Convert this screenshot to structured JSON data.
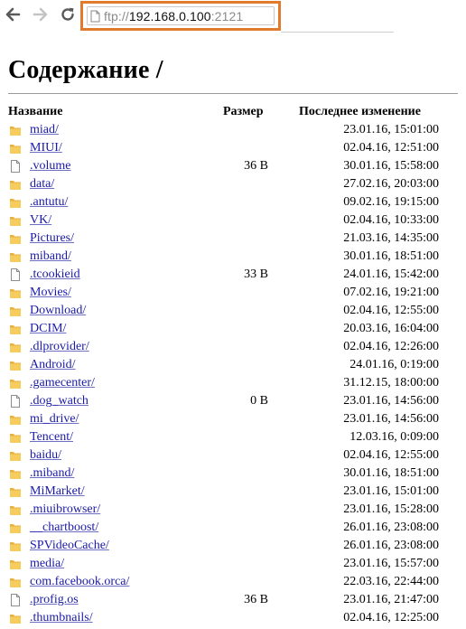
{
  "browser": {
    "url_scheme": "ftp://",
    "url_host": "192.168.0.100",
    "url_port": ":2121"
  },
  "page": {
    "title": "Содержание /",
    "columns": {
      "name": "Название",
      "size": "Размер",
      "modified": "Последнее изменение"
    }
  },
  "entries": [
    {
      "name": "miad/",
      "type": "folder",
      "size": "",
      "modified": "23.01.16, 15:01:00"
    },
    {
      "name": "MIUI/",
      "type": "folder",
      "size": "",
      "modified": "02.04.16, 12:51:00"
    },
    {
      "name": ".volume",
      "type": "file",
      "size": "36 B",
      "modified": "30.01.16, 15:58:00"
    },
    {
      "name": "data/",
      "type": "folder",
      "size": "",
      "modified": "27.02.16, 20:03:00"
    },
    {
      "name": ".antutu/",
      "type": "folder",
      "size": "",
      "modified": "09.02.16, 19:15:00"
    },
    {
      "name": "VK/",
      "type": "folder",
      "size": "",
      "modified": "02.04.16, 10:33:00"
    },
    {
      "name": "Pictures/",
      "type": "folder",
      "size": "",
      "modified": "21.03.16, 14:35:00"
    },
    {
      "name": "miband/",
      "type": "folder",
      "size": "",
      "modified": "30.01.16, 18:51:00"
    },
    {
      "name": ".tcookieid",
      "type": "file",
      "size": "33 B",
      "modified": "24.01.16, 15:42:00"
    },
    {
      "name": "Movies/",
      "type": "folder",
      "size": "",
      "modified": "07.02.16, 19:21:00"
    },
    {
      "name": "Download/",
      "type": "folder",
      "size": "",
      "modified": "02.04.16, 12:55:00"
    },
    {
      "name": "DCIM/",
      "type": "folder",
      "size": "",
      "modified": "20.03.16, 16:04:00"
    },
    {
      "name": ".dlprovider/",
      "type": "folder",
      "size": "",
      "modified": "02.04.16, 12:26:00"
    },
    {
      "name": "Android/",
      "type": "folder",
      "size": "",
      "modified": "24.01.16, 0:19:00"
    },
    {
      "name": ".gamecenter/",
      "type": "folder",
      "size": "",
      "modified": "31.12.15, 18:00:00"
    },
    {
      "name": ".dog_watch",
      "type": "file",
      "size": "0 B",
      "modified": "23.01.16, 14:56:00"
    },
    {
      "name": "mi_drive/",
      "type": "folder",
      "size": "",
      "modified": "23.01.16, 14:56:00"
    },
    {
      "name": "Tencent/",
      "type": "folder",
      "size": "",
      "modified": "12.03.16, 0:09:00"
    },
    {
      "name": "baidu/",
      "type": "folder",
      "size": "",
      "modified": "02.04.16, 12:55:00"
    },
    {
      "name": ".miband/",
      "type": "folder",
      "size": "",
      "modified": "30.01.16, 18:51:00"
    },
    {
      "name": "MiMarket/",
      "type": "folder",
      "size": "",
      "modified": "23.01.16, 15:01:00"
    },
    {
      "name": ".miuibrowser/",
      "type": "folder",
      "size": "",
      "modified": "23.01.16, 15:28:00"
    },
    {
      "name": "__chartboost/",
      "type": "folder",
      "size": "",
      "modified": "26.01.16, 23:08:00"
    },
    {
      "name": "SPVideoCache/",
      "type": "folder",
      "size": "",
      "modified": "26.01.16, 23:08:00"
    },
    {
      "name": "media/",
      "type": "folder",
      "size": "",
      "modified": "23.01.16, 15:57:00"
    },
    {
      "name": "com.facebook.orca/",
      "type": "folder",
      "size": "",
      "modified": "22.03.16, 22:44:00"
    },
    {
      "name": ".profig.os",
      "type": "file",
      "size": "36 B",
      "modified": "23.01.16, 21:47:00"
    },
    {
      "name": ".thumbnails/",
      "type": "folder",
      "size": "",
      "modified": "02.04.16, 12:25:00"
    }
  ],
  "icons": {
    "back": "back-arrow-icon",
    "forward": "forward-arrow-icon",
    "reload": "reload-icon",
    "page": "page-icon",
    "folder": "folder-icon",
    "file": "file-icon"
  },
  "colors": {
    "link": "#1a1aa6",
    "url_highlight": "#e07a2c",
    "folder": "#f2c04a"
  }
}
